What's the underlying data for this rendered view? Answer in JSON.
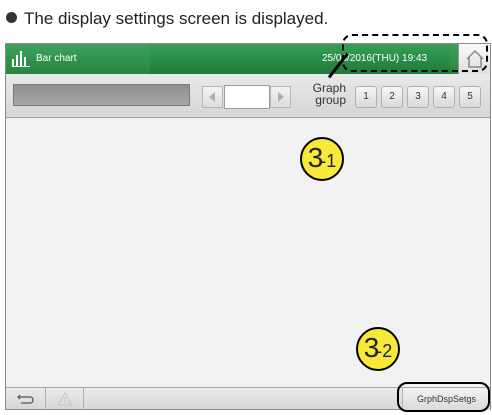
{
  "caption": "The display settings screen is displayed.",
  "titlebar": {
    "title": "Bar chart",
    "datetime": "25/08/2016(THU) 19:43"
  },
  "toolbar": {
    "graph_group_label": "Graph group",
    "group_buttons": [
      "1",
      "2",
      "3",
      "4",
      "5"
    ]
  },
  "bottombar": {
    "settings_button": "GrphDspSetgs"
  },
  "callouts": [
    {
      "main": "3",
      "sub": "-1"
    },
    {
      "main": "3",
      "sub": "-2"
    }
  ],
  "colors": {
    "titlebar_green": "#268442",
    "callout_yellow": "#f7e83a"
  }
}
